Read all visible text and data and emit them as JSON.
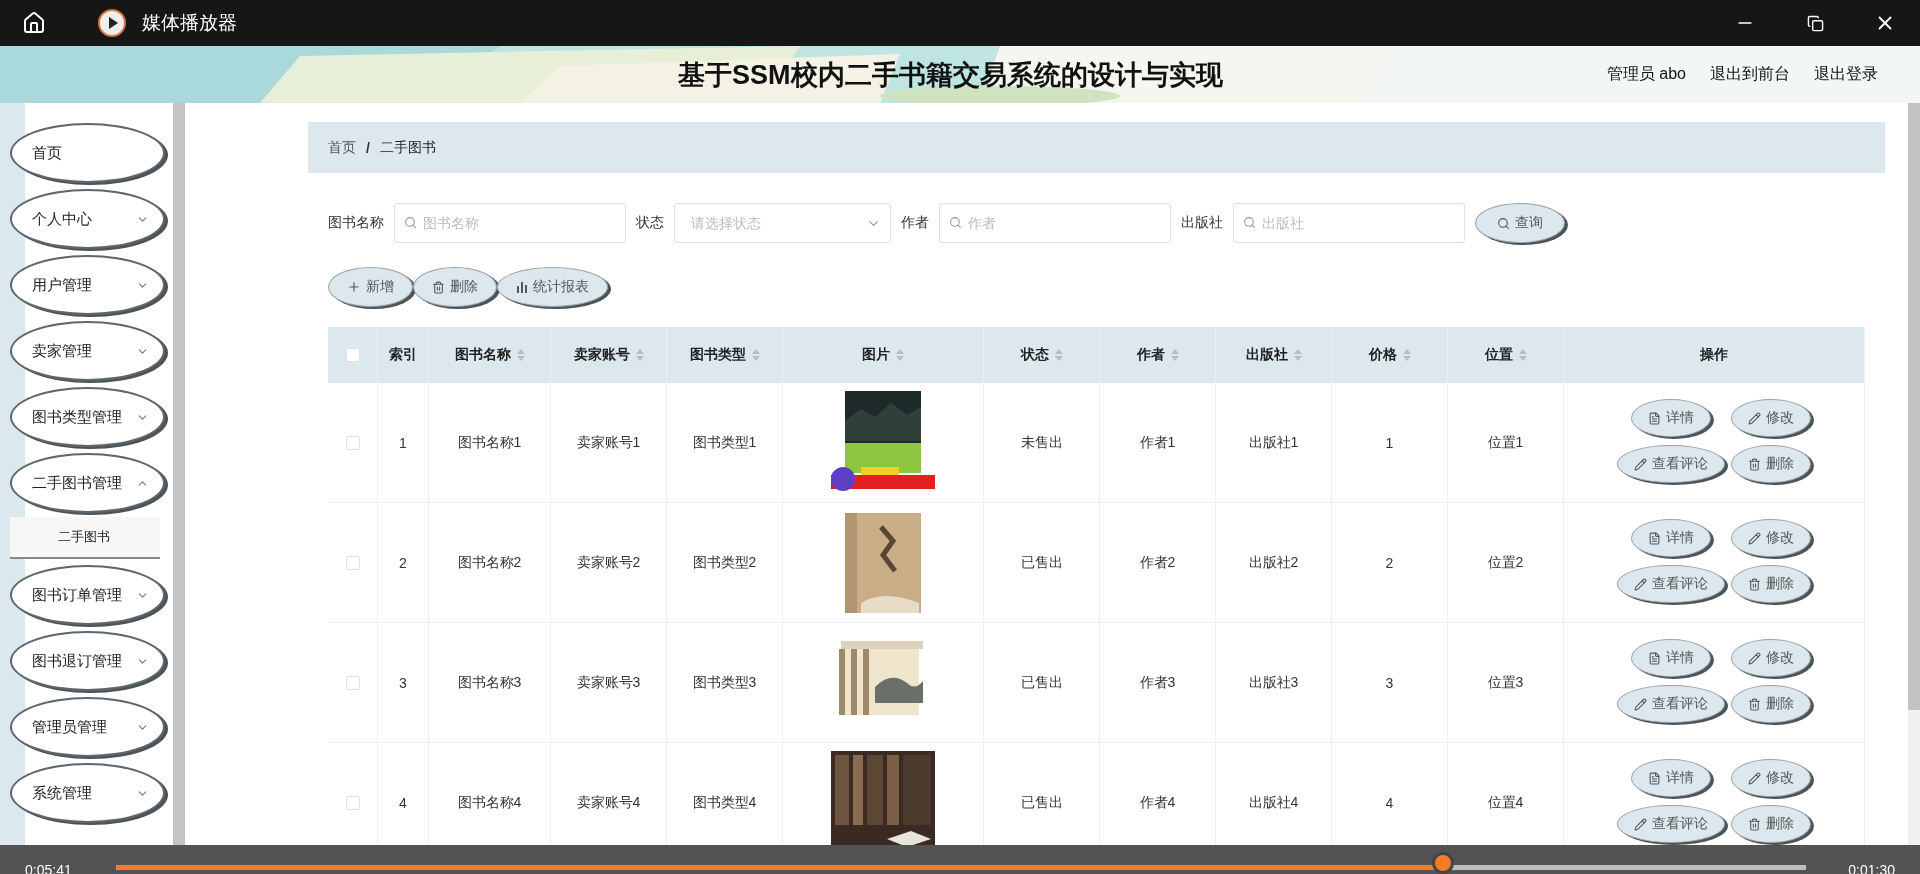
{
  "player": {
    "title": "媒体播放器",
    "elapsed": "0:05:41",
    "remaining": "0:01:30",
    "level": 0.785
  },
  "header": {
    "banner": {
      "kind": "picture"
    },
    "title": "基于SSM校内二手书籍交易系统的设计与实现",
    "user": "管理员 abo",
    "links": [
      "退出到前台",
      "退出登录"
    ]
  },
  "sidebar": {
    "items": [
      {
        "label": "首页",
        "kind": "link"
      },
      {
        "label": "个人中心",
        "kind": "submenu",
        "expanded": false
      },
      {
        "label": "用户管理",
        "kind": "submenu",
        "expanded": false
      },
      {
        "label": "卖家管理",
        "kind": "submenu",
        "expanded": false
      },
      {
        "label": "图书类型管理",
        "kind": "submenu",
        "expanded": false
      },
      {
        "label": "二手图书管理",
        "kind": "submenu",
        "expanded": true,
        "children": [
          {
            "label": "二手图书"
          }
        ]
      },
      {
        "label": "图书订单管理",
        "kind": "submenu",
        "expanded": false
      },
      {
        "label": "图书退订管理",
        "kind": "submenu",
        "expanded": false
      },
      {
        "label": "管理员管理",
        "kind": "submenu",
        "expanded": false
      },
      {
        "label": "系统管理",
        "kind": "submenu",
        "expanded": false
      }
    ]
  },
  "breadcrumb": {
    "items": [
      "首页",
      "二手图书"
    ],
    "separator": "/"
  },
  "search": {
    "fields": [
      {
        "label": "图书名称",
        "placeholder": "图书名称",
        "kind": "text"
      },
      {
        "label": "状态",
        "placeholder": "请选择状态",
        "kind": "select"
      },
      {
        "label": "作者",
        "placeholder": "作者",
        "kind": "text"
      },
      {
        "label": "出版社",
        "placeholder": "出版社",
        "kind": "text"
      }
    ],
    "button": "查询"
  },
  "actions": [
    {
      "label": "新增",
      "kind": "add"
    },
    {
      "label": "删除",
      "kind": "delete"
    },
    {
      "label": "统计报表",
      "kind": "report"
    }
  ],
  "table": {
    "all_checked": false,
    "columns": [
      {
        "label": "索引",
        "sortable": false
      },
      {
        "label": "图书名称",
        "sortable": true
      },
      {
        "label": "卖家账号",
        "sortable": true
      },
      {
        "label": "图书类型",
        "sortable": true
      },
      {
        "label": "图片",
        "sortable": true
      },
      {
        "label": "状态",
        "sortable": true
      },
      {
        "label": "作者",
        "sortable": true
      },
      {
        "label": "出版社",
        "sortable": true
      },
      {
        "label": "价格",
        "sortable": true
      },
      {
        "label": "位置",
        "sortable": true
      },
      {
        "label": "操作",
        "sortable": false
      }
    ],
    "rows": [
      {
        "checked": false,
        "index": "1",
        "name": "图书名称1",
        "seller": "卖家账号1",
        "type": "图书类型1",
        "picture": {
          "kind": "picture"
        },
        "status": "未售出",
        "author": "作者1",
        "publisher": "出版社1",
        "price": "1",
        "location": "位置1",
        "actions": [
          {
            "label": "详情",
            "kind": "detail"
          },
          {
            "label": "修改",
            "kind": "edit"
          },
          {
            "label": "查看评论",
            "kind": "edit"
          },
          {
            "label": "删除",
            "kind": "delete"
          }
        ]
      },
      {
        "checked": false,
        "index": "2",
        "name": "图书名称2",
        "seller": "卖家账号2",
        "type": "图书类型2",
        "picture": {
          "kind": "picture"
        },
        "status": "已售出",
        "author": "作者2",
        "publisher": "出版社2",
        "price": "2",
        "location": "位置2",
        "actions": [
          {
            "label": "详情",
            "kind": "detail"
          },
          {
            "label": "修改",
            "kind": "edit"
          },
          {
            "label": "查看评论",
            "kind": "edit"
          },
          {
            "label": "删除",
            "kind": "delete"
          }
        ]
      },
      {
        "checked": false,
        "index": "3",
        "name": "图书名称3",
        "seller": "卖家账号3",
        "type": "图书类型3",
        "picture": {
          "kind": "picture"
        },
        "status": "已售出",
        "author": "作者3",
        "publisher": "出版社3",
        "price": "3",
        "location": "位置3",
        "actions": [
          {
            "label": "详情",
            "kind": "detail"
          },
          {
            "label": "修改",
            "kind": "edit"
          },
          {
            "label": "查看评论",
            "kind": "edit"
          },
          {
            "label": "删除",
            "kind": "delete"
          }
        ]
      },
      {
        "checked": false,
        "index": "4",
        "name": "图书名称4",
        "seller": "卖家账号4",
        "type": "图书类型4",
        "picture": {
          "kind": "picture"
        },
        "status": "已售出",
        "author": "作者4",
        "publisher": "出版社4",
        "price": "4",
        "location": "位置4",
        "actions": [
          {
            "label": "详情",
            "kind": "detail"
          },
          {
            "label": "修改",
            "kind": "edit"
          },
          {
            "label": "查看评论",
            "kind": "edit"
          },
          {
            "label": "删除",
            "kind": "delete"
          }
        ]
      }
    ]
  }
}
